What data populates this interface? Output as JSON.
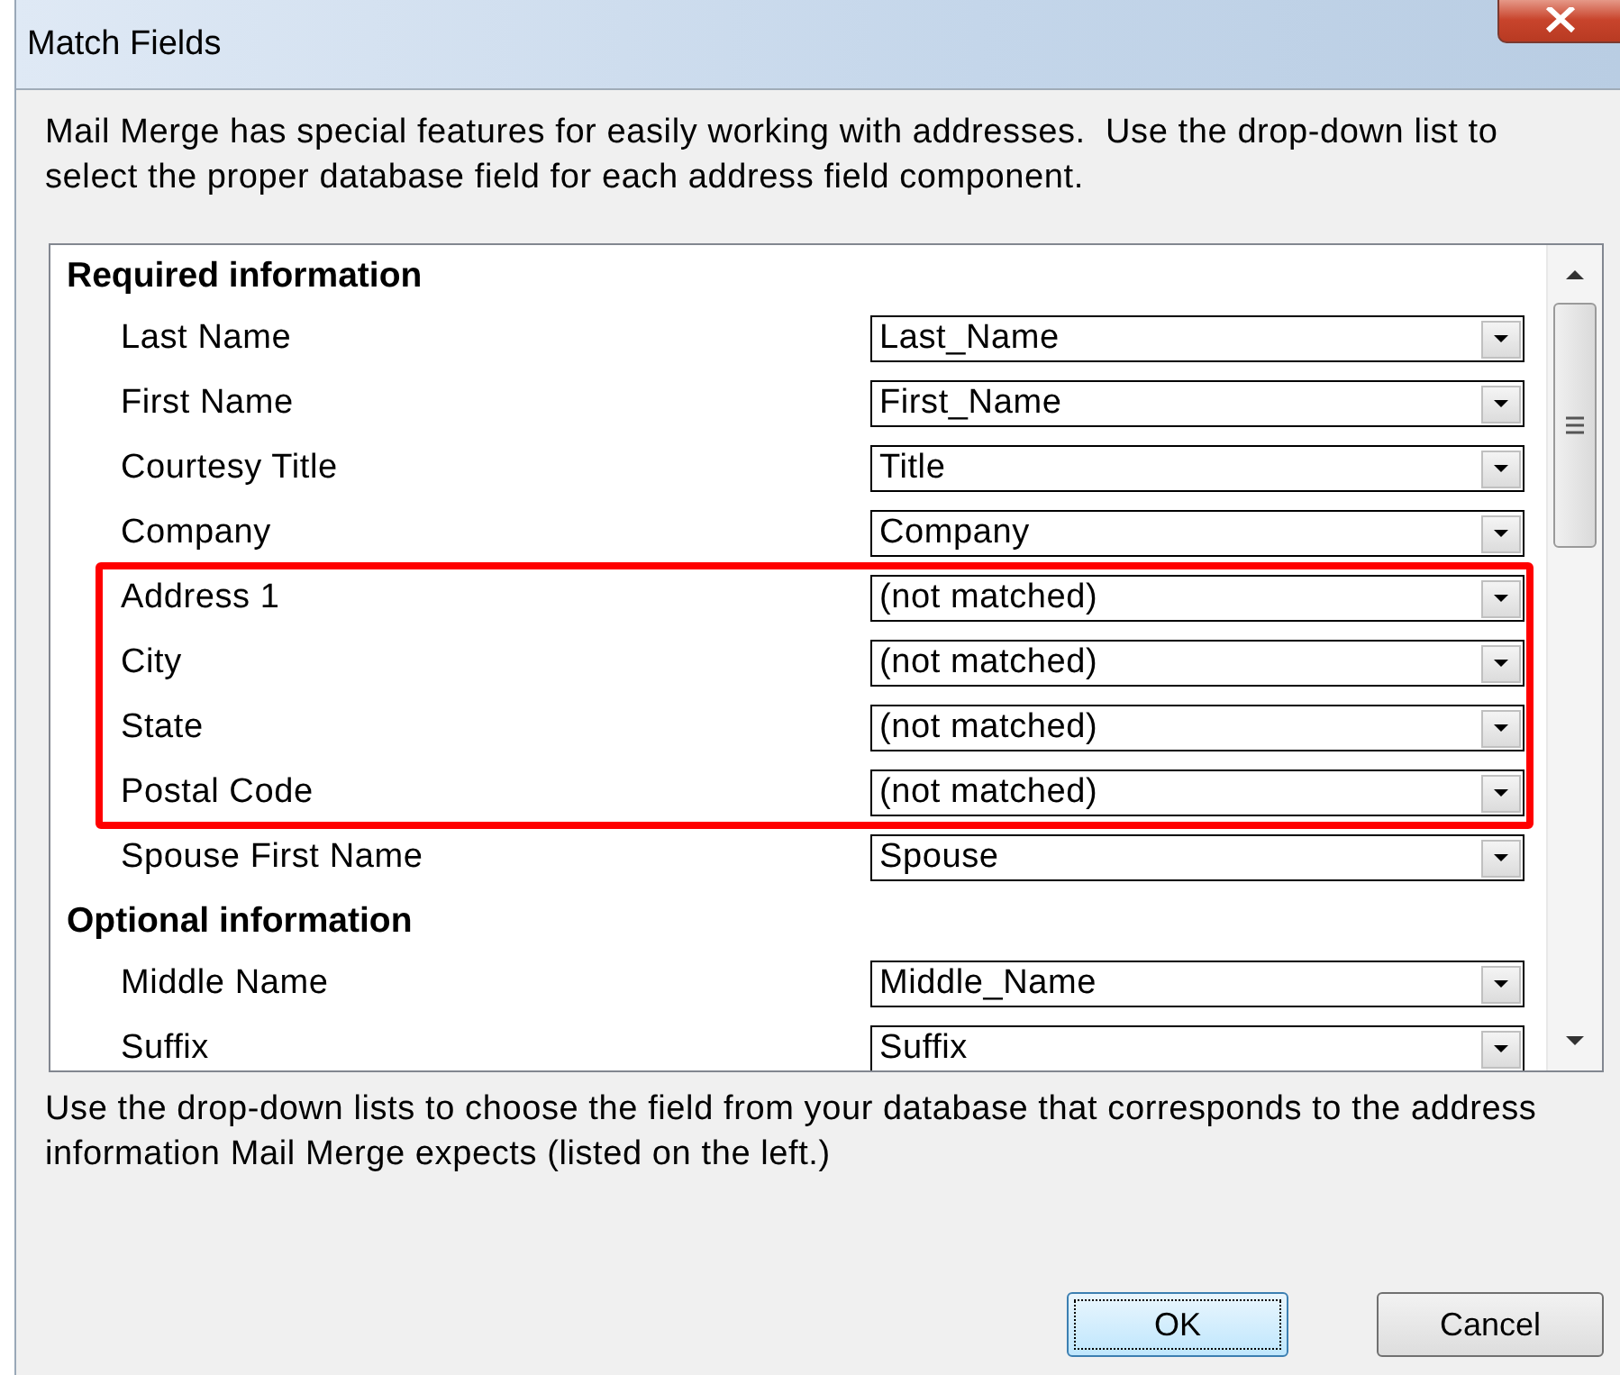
{
  "window": {
    "title": "Match Fields"
  },
  "intro": "Mail Merge has special features for easily working with addresses.  Use the drop-down list to select the proper database field for each address field component.",
  "sections": [
    {
      "heading": "Required information",
      "rows": [
        {
          "kind": "field",
          "label": "Last Name",
          "value": "Last_Name"
        },
        {
          "kind": "field",
          "label": "First Name",
          "value": "First_Name"
        },
        {
          "kind": "field",
          "label": "Courtesy Title",
          "value": "Title"
        },
        {
          "kind": "field",
          "label": "Company",
          "value": "Company"
        },
        {
          "kind": "highlight_group",
          "rows": [
            {
              "label": "Address 1",
              "value": "(not matched)"
            },
            {
              "label": "City",
              "value": "(not matched)"
            },
            {
              "label": "State",
              "value": "(not matched)"
            },
            {
              "label": "Postal Code",
              "value": "(not matched)"
            }
          ]
        },
        {
          "kind": "field",
          "label": "Spouse First Name",
          "value": "Spouse"
        }
      ]
    },
    {
      "heading": "Optional information",
      "rows": [
        {
          "kind": "field",
          "label": "Middle Name",
          "value": "Middle_Name"
        },
        {
          "kind": "field",
          "label": "Suffix",
          "value": "Suffix"
        }
      ]
    }
  ],
  "hint": "Use the drop-down lists to choose the field from your database that corresponds to the address information Mail Merge expects (listed on the left.)",
  "buttons": [
    {
      "label": "OK",
      "default": true
    },
    {
      "label": "Cancel",
      "default": false
    }
  ]
}
